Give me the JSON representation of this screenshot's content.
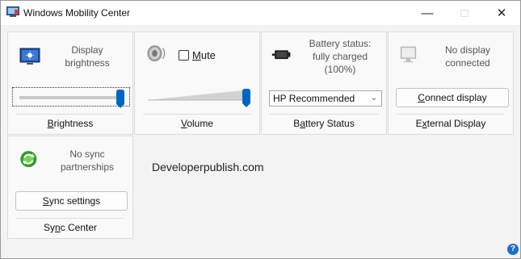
{
  "window": {
    "title": "Windows Mobility Center",
    "minimize": "—",
    "maximize": "□",
    "close": "✕"
  },
  "tiles": {
    "brightness": {
      "desc_line1": "Display",
      "desc_line2": "brightness",
      "caption_pre": "",
      "caption_key": "B",
      "caption_post": "rightness",
      "level": 1.0,
      "icon": "display-brightness-icon"
    },
    "volume": {
      "mute_label_key": "M",
      "mute_label_post": "ute",
      "mute_checked": false,
      "caption_pre": "",
      "caption_key": "V",
      "caption_post": "olume",
      "level": 1.0,
      "icon": "speaker-icon"
    },
    "battery": {
      "desc_line1": "Battery status:",
      "desc_line2": "fully charged",
      "desc_line3": "(100%)",
      "plan_value": "HP Recommended",
      "caption_pre": "B",
      "caption_key": "a",
      "caption_post": "ttery Status",
      "icon": "battery-icon"
    },
    "display": {
      "desc_line1": "No display",
      "desc_line2": "connected",
      "button_key": "C",
      "button_post": "onnect display",
      "caption_pre": "E",
      "caption_key": "x",
      "caption_post": "ternal Display",
      "icon": "external-display-icon"
    },
    "sync": {
      "desc_line1": "No sync",
      "desc_line2": "partnerships",
      "button_key": "S",
      "button_post": "ync settings",
      "caption_pre": "Sy",
      "caption_key": "n",
      "caption_post": "c Center",
      "icon": "sync-icon"
    }
  },
  "watermark": "Developerpublish.com",
  "help": "?",
  "colors": {
    "accent": "#0067c0",
    "background": "#f3f3f3",
    "tile": "#f9f9f9"
  }
}
